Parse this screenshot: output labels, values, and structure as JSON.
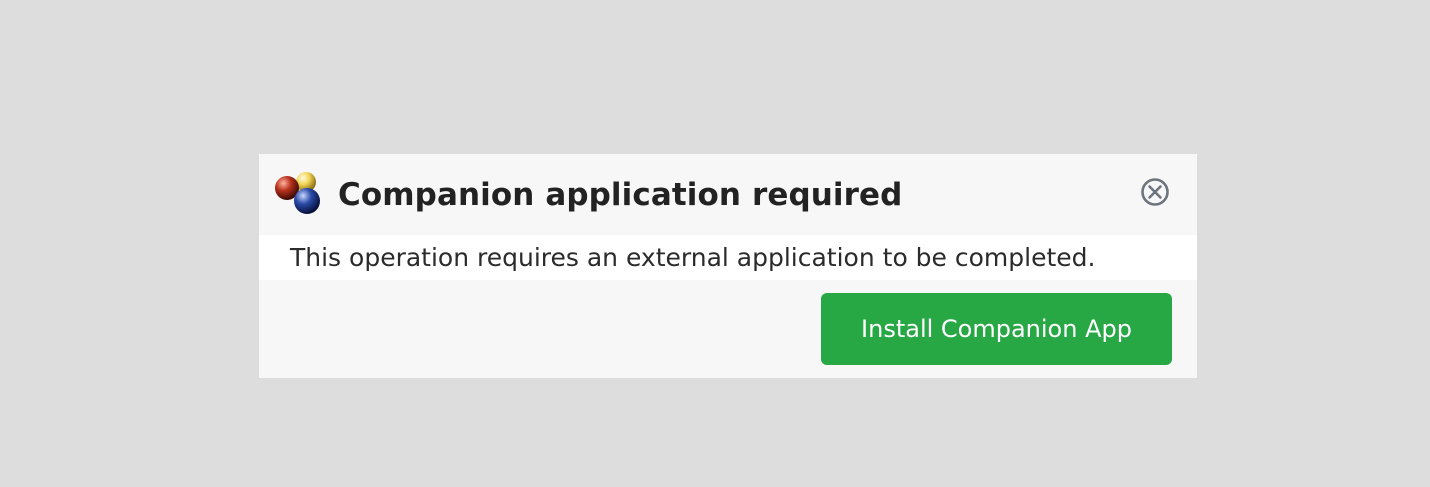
{
  "dialog": {
    "title": "Companion application required",
    "message": "This operation requires an external application to be completed.",
    "logo_icon": "three-spheres-logo-icon",
    "close_icon": "circle-x-close-icon",
    "install_button_label": "Install Companion App"
  },
  "colors": {
    "backdrop": "#dddddd",
    "dialog_bg": "#f7f7f7",
    "message_bg": "#ffffff",
    "button_bg": "#28a745",
    "button_text": "#ffffff",
    "close_icon": "#6c757d"
  }
}
